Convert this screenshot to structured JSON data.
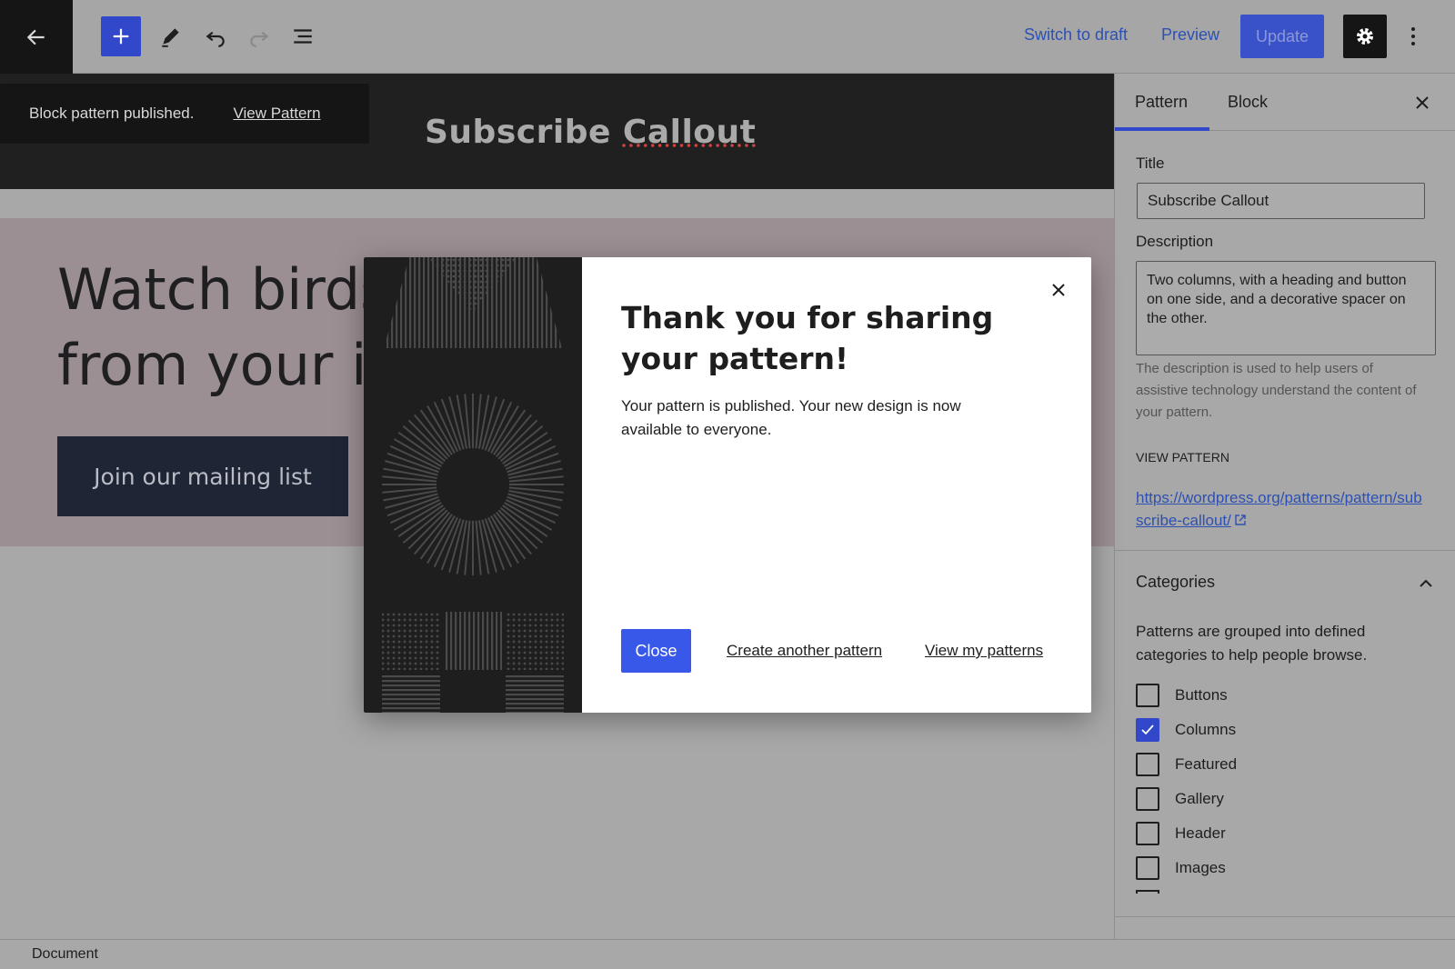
{
  "toolbar": {
    "switch_to_draft": "Switch to draft",
    "preview": "Preview",
    "update": "Update"
  },
  "snackbar": {
    "message": "Block pattern published.",
    "link": "View Pattern"
  },
  "canvas": {
    "title_part1": "Subscribe ",
    "title_part2": "Callout",
    "hero_line1": "Watch birds",
    "hero_line2": "from your inb",
    "button": "Join our mailing list"
  },
  "footer": {
    "label": "Document"
  },
  "sidebar": {
    "tabs": [
      "Pattern",
      "Block"
    ],
    "title_label": "Title",
    "title_value": "Subscribe Callout",
    "description_label": "Description",
    "description_value": "Two columns, with a heading and button on one side, and a decorative spacer on the other.",
    "description_help": "The description is used to help users of assistive technology understand the content of your pattern.",
    "view_pattern_label": "VIEW PATTERN",
    "view_pattern_url": "https://wordpress.org/patterns/pattern/subscribe-callout/",
    "categories_title": "Categories",
    "categories_help": "Patterns are grouped into defined categories to help people browse.",
    "categories": [
      {
        "label": "Buttons",
        "checked": false
      },
      {
        "label": "Columns",
        "checked": true
      },
      {
        "label": "Featured",
        "checked": false
      },
      {
        "label": "Gallery",
        "checked": false
      },
      {
        "label": "Header",
        "checked": false
      },
      {
        "label": "Images",
        "checked": false
      }
    ]
  },
  "modal": {
    "title": "Thank you for sharing your pattern!",
    "body": "Your pattern is published. Your new design is now available to everyone.",
    "close_button": "Close",
    "create_link": "Create another pattern",
    "view_link": "View my patterns"
  },
  "colors": {
    "accent": "#3858e9",
    "link": "#2d50b3",
    "dark": "#1e1e1e"
  }
}
